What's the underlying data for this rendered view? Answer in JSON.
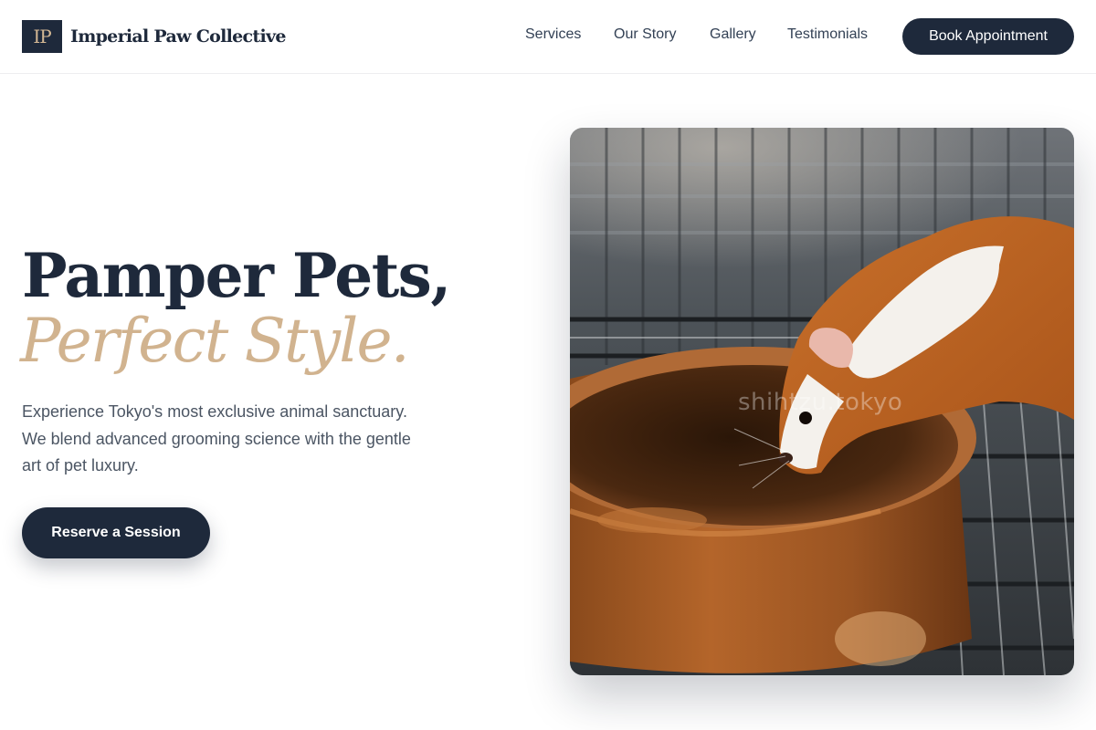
{
  "brand": {
    "monogram": "IP",
    "name": "Imperial Paw Collective"
  },
  "nav": {
    "links": [
      "Services",
      "Our Story",
      "Gallery",
      "Testimonials"
    ],
    "cta": "Book Appointment"
  },
  "hero": {
    "headline_line1": "Pamper Pets,",
    "headline_line2": "Perfect Style.",
    "description": "Experience Tokyo's most exclusive animal sanctuary. We blend advanced grooming science with the gentle art of pet luxury.",
    "cta": "Reserve a Session",
    "image": {
      "subject": "guinea pig drinking from ceramic bowl",
      "watermark": "shihtzu.tokyo"
    }
  },
  "colors": {
    "navy": "#1e293b",
    "gold": "#d1b38f",
    "body_text": "#4b5563"
  }
}
